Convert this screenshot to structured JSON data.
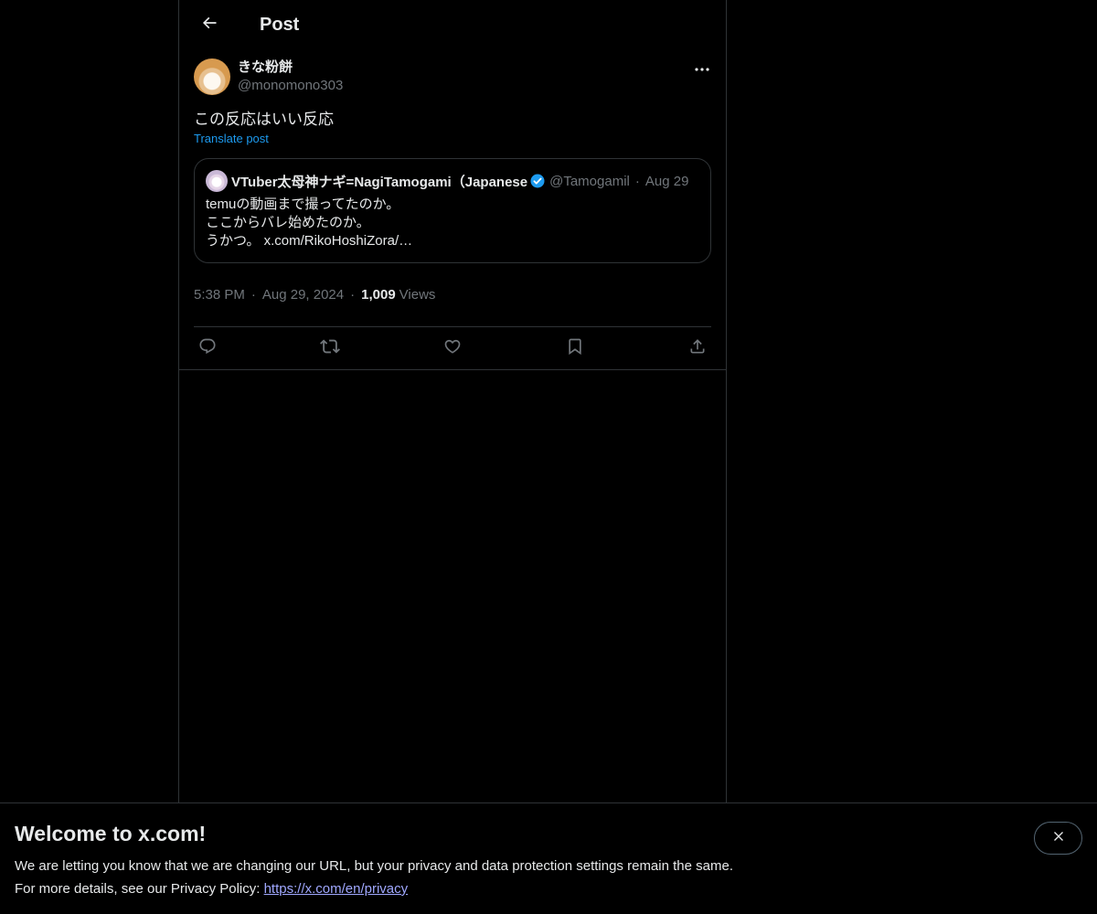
{
  "topbar": {
    "title": "Post"
  },
  "post": {
    "author": {
      "display_name": "きな粉餅",
      "handle": "@monomono303"
    },
    "text": "この反応はいい反応",
    "translate_label": "Translate post",
    "quote": {
      "display_name": "VTuber太母神ナギ=NagiTamogami（Japanese",
      "handle": "@Tamogamil",
      "separator": "·",
      "date": "Aug 29",
      "lines": [
        "temuの動画まで撮ってたのか。",
        "ここからバレ始めたのか。",
        "うかつ。 x.com/RikoHoshiZora/…"
      ],
      "verified_color": "#1d9bf0"
    },
    "time": "5:38 PM",
    "separator": "·",
    "date": "Aug 29, 2024",
    "views_count": "1,009",
    "views_label": "Views"
  },
  "actions": [
    "reply-icon",
    "repost-icon",
    "like-icon",
    "bookmark-icon",
    "share-icon"
  ],
  "banner": {
    "title": "Welcome to x.com!",
    "line1": "We are letting you know that we are changing our URL, but your privacy and data protection settings remain the same.",
    "line2_prefix": "For more details, see our Privacy Policy: ",
    "link": "https://x.com/en/privacy"
  },
  "colors": {
    "background": "#000000",
    "text": "#e7e9ea",
    "muted": "#71767b",
    "accent": "#1d9bf0",
    "border": "#2f3336"
  }
}
